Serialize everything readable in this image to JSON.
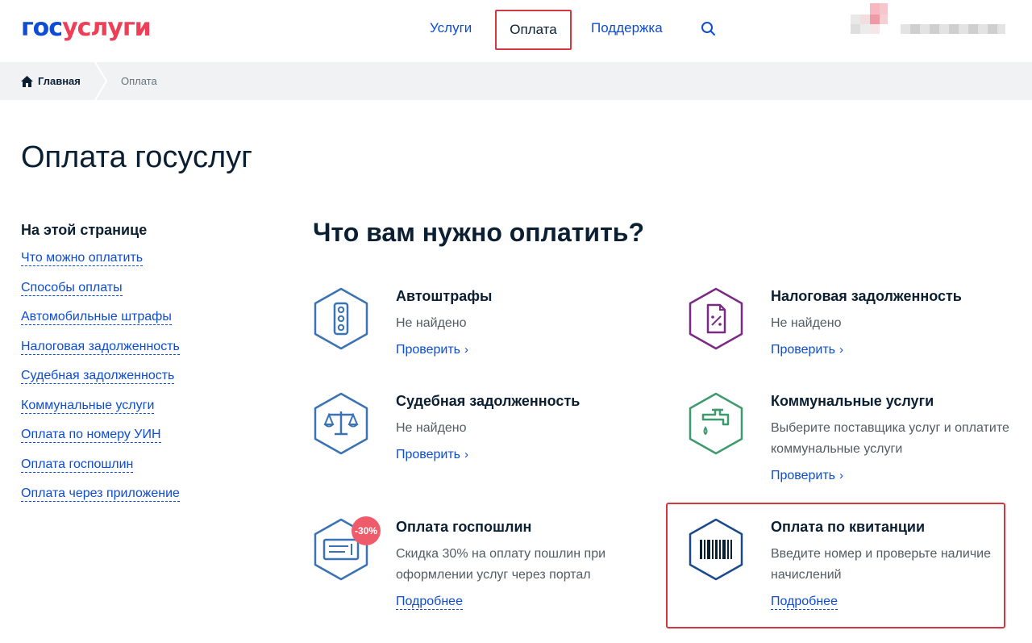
{
  "header": {
    "logo_part1": "гос",
    "logo_part2": "услуги",
    "nav": [
      "Услуги",
      "Оплата",
      "Поддержка"
    ],
    "search_icon": "search-icon",
    "colors": {
      "brand_blue": "#0d4cd3",
      "brand_red": "#ee3f58",
      "highlight": "#d2383f"
    }
  },
  "breadcrumb": {
    "home_label": "Главная",
    "current": "Оплата"
  },
  "page_title": "Оплата госуслуг",
  "sidebar": {
    "heading": "На этой странице",
    "links": [
      "Что можно оплатить",
      "Способы оплаты",
      "Автомобильные штрафы",
      "Налоговая задолженность",
      "Судебная задолженность",
      "Коммунальные услуги",
      "Оплата по номеру УИН",
      "Оплата госпошлин",
      "Оплата через приложение"
    ]
  },
  "main": {
    "title": "Что вам нужно оплатить?",
    "cards": [
      {
        "title": "Автоштрафы",
        "desc": "Не найдено",
        "link": "Проверить",
        "icon": "traffic-light-icon",
        "color": "#3b72b5"
      },
      {
        "title": "Налоговая задолженность",
        "desc": "Не найдено",
        "link": "Проверить",
        "icon": "tax-document-icon",
        "color": "#7b2a83"
      },
      {
        "title": "Судебная задолженность",
        "desc": "Не найдено",
        "link": "Проверить",
        "icon": "scales-icon",
        "color": "#3b72b5"
      },
      {
        "title": "Коммунальные услуги",
        "desc": "Выберите поставщика услуг и оплатите коммунальные услуги",
        "link": "Проверить",
        "icon": "water-tap-icon",
        "color": "#3d9a6e"
      },
      {
        "title": "Оплата госпошлин",
        "desc": "Скидка 30% на оплату пошлин при оформлении услуг через портал",
        "link": "Подробнее",
        "icon": "check-document-icon",
        "badge": "-30%",
        "color": "#3b72b5"
      },
      {
        "title": "Оплата по квитанции",
        "desc": "Введите номер и проверьте наличие начислений",
        "link": "Подробнее",
        "icon": "barcode-icon",
        "color": "#1b4a8c"
      }
    ]
  }
}
